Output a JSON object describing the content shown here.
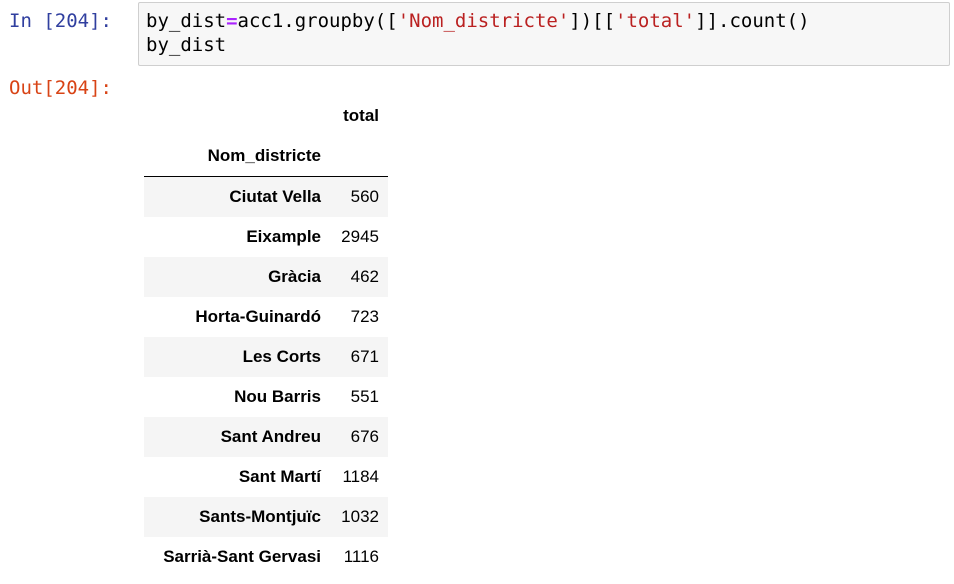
{
  "input_cell": {
    "prompt": "In [204]:",
    "code_line1": {
      "a": "by_dist",
      "op": "=",
      "b": "acc1.groupby([",
      "s1": "'Nom_districte'",
      "c": "])[[",
      "s2": "'total'",
      "d": "]].count()"
    },
    "code_line2": "by_dist"
  },
  "output_cell": {
    "prompt": "Out[204]:",
    "table": {
      "column_header": "total",
      "index_name": "Nom_districte",
      "rows": [
        {
          "index": "Ciutat Vella",
          "total": "560"
        },
        {
          "index": "Eixample",
          "total": "2945"
        },
        {
          "index": "Gràcia",
          "total": "462"
        },
        {
          "index": "Horta-Guinardó",
          "total": "723"
        },
        {
          "index": "Les Corts",
          "total": "671"
        },
        {
          "index": "Nou Barris",
          "total": "551"
        },
        {
          "index": "Sant Andreu",
          "total": "676"
        },
        {
          "index": "Sant Martí",
          "total": "1184"
        },
        {
          "index": "Sants-Montjuïc",
          "total": "1032"
        },
        {
          "index": "Sarrià-Sant Gervasi",
          "total": "1116"
        }
      ]
    }
  },
  "colors": {
    "in_prompt": "#303f9f",
    "out_prompt": "#d84315",
    "string": "#ba2121",
    "operator": "#aa22ff",
    "cell_background": "#f7f7f7",
    "row_stripe": "#f5f5f5"
  }
}
